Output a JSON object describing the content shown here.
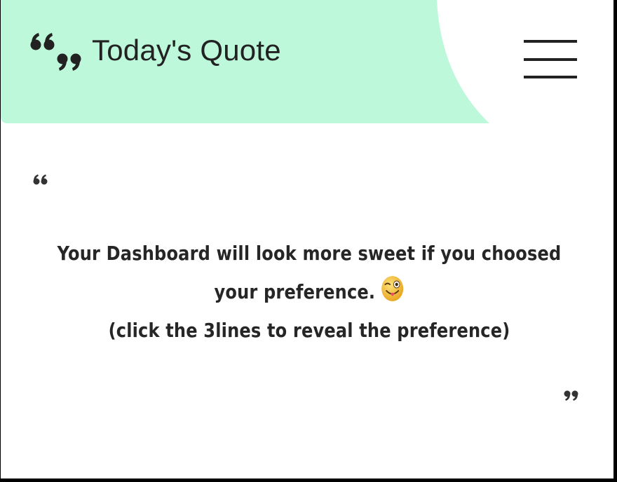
{
  "header": {
    "title": "Today's Quote",
    "logo_icon": "quote-marks-icon",
    "menu_icon": "hamburger-menu-icon",
    "accent_color": "#bdf8db"
  },
  "quote": {
    "line1": "Your Dashboard will look more sweet if you choosed",
    "line2": "your preference.",
    "line3": "(click the 3lines to reveal the preference)",
    "emoji": "winking-tongue-emoji",
    "open_mark_icon": "open-quote-icon",
    "close_mark_icon": "close-quote-icon"
  },
  "colors": {
    "text": "#262626",
    "background": "#ffffff",
    "frame": "#000000"
  }
}
